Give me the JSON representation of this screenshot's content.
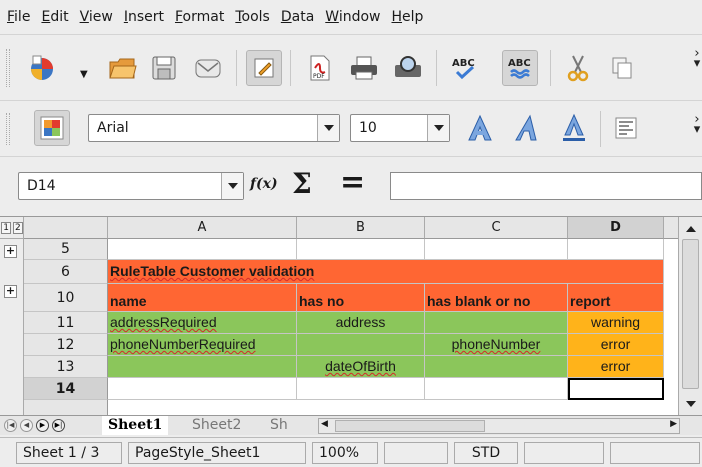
{
  "menu": [
    {
      "key": "F",
      "rest": "ile"
    },
    {
      "key": "E",
      "rest": "dit"
    },
    {
      "key": "V",
      "rest": "iew"
    },
    {
      "key": "I",
      "rest": "nsert"
    },
    {
      "key": "F",
      "rest": "ormat",
      "pre": ""
    },
    {
      "key": "T",
      "rest": "ools"
    },
    {
      "key": "D",
      "rest": "ata"
    },
    {
      "key": "W",
      "rest": "indow"
    },
    {
      "key": "H",
      "rest": "elp"
    }
  ],
  "toolbar2": {
    "font_name": "Arial",
    "font_size": "10"
  },
  "formula": {
    "name_box": "D14",
    "fx_label": "f(x)",
    "sum_label": "Σ",
    "equals_label": "=",
    "input_value": ""
  },
  "grid": {
    "outline_levels": [
      "1",
      "2"
    ],
    "columns": [
      "A",
      "B",
      "C",
      "D"
    ],
    "rows": [
      {
        "num": "5",
        "cells": [
          "",
          "",
          "",
          ""
        ]
      },
      {
        "num": "6",
        "cells": [
          "RuleTable Customer validation",
          "",
          "",
          ""
        ]
      },
      {
        "num": "10",
        "cells": [
          "name",
          "has no",
          "has blank or no",
          "report"
        ]
      },
      {
        "num": "11",
        "cells": [
          "addressRequired",
          "address",
          "",
          "warning"
        ]
      },
      {
        "num": "12",
        "cells": [
          "phoneNumberRequired",
          "",
          "phoneNumber",
          "error"
        ]
      },
      {
        "num": "13",
        "cells": [
          "",
          "dateOfBirth",
          "",
          "error"
        ]
      },
      {
        "num": "14",
        "cells": [
          "",
          "",
          "",
          ""
        ]
      }
    ]
  },
  "tabs": [
    "Sheet1",
    "Sheet2",
    "Sh"
  ],
  "status": {
    "sheet": "Sheet 1 / 3",
    "page_style": "PageStyle_Sheet1",
    "zoom": "100%",
    "mode": "STD"
  },
  "colors": {
    "header_red": "#ff6633",
    "rule_green": "#8bc65b",
    "report_amber": "#ffb31a"
  }
}
